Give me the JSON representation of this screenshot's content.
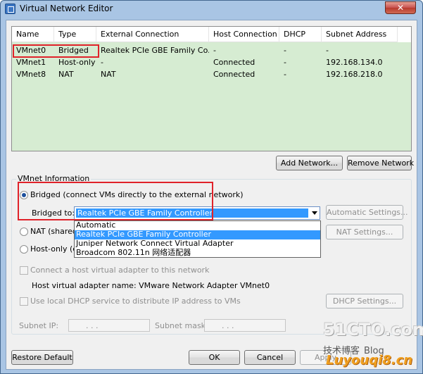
{
  "window": {
    "title": "Virtual Network Editor",
    "close_label": "✕"
  },
  "table": {
    "columns": [
      "Name",
      "Type",
      "External Connection",
      "Host Connection",
      "DHCP",
      "Subnet Address"
    ],
    "rows": [
      [
        "VMnet0",
        "Bridged",
        "Realtek PCIe GBE Family Co...",
        "-",
        "-",
        "-"
      ],
      [
        "VMnet1",
        "Host-only",
        "-",
        "Connected",
        "-",
        "192.168.134.0"
      ],
      [
        "VMnet8",
        "NAT",
        "NAT",
        "Connected",
        "-",
        "192.168.218.0"
      ]
    ]
  },
  "buttons": {
    "add_network": "Add Network...",
    "remove_network": "Remove Network",
    "automatic_settings": "Automatic Settings...",
    "nat_settings": "NAT Settings...",
    "dhcp_settings": "DHCP Settings...",
    "restore_default": "Restore Default",
    "ok": "OK",
    "cancel": "Cancel",
    "apply": "Apply"
  },
  "vmnet_info": {
    "legend": "VMnet Information",
    "bridged_label": "Bridged (connect VMs directly to the external network)",
    "bridged_to_label": "Bridged to:",
    "bridged_to_value": "Realtek PCIe GBE Family Controller",
    "dropdown_options": [
      "Automatic",
      "Realtek PCIe GBE Family Controller",
      "Juniper Network Connect Virtual Adapter",
      "Broadcom 802.11n 网络适配器"
    ],
    "dropdown_selected_index": 1,
    "nat_label": "NAT (shared",
    "hostonly_label": "Host-only (co",
    "connect_adapter_label": "Connect a host virtual adapter to this network",
    "adapter_name_label": "Host virtual adapter name: VMware Network Adapter VMnet0",
    "dhcp_label": "Use local DHCP service to distribute IP address to VMs",
    "subnet_ip_label": "Subnet IP:",
    "subnet_mask_label": "Subnet mask:",
    "ip_dots": ".   .   ."
  },
  "watermark": {
    "site": "51CTO.com",
    "blog_text": "技术博客",
    "blog_word": "Blog",
    "cn_text": "Luyouqi8.cn"
  },
  "colors": {
    "list_bg": "#d6ecd2",
    "highlight": "#e0222a",
    "selection": "#3399ff"
  }
}
